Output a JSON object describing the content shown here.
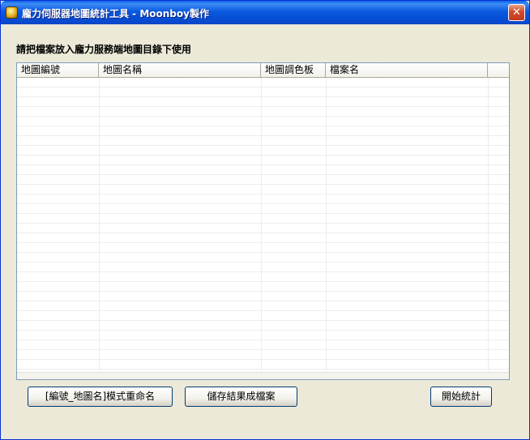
{
  "window": {
    "title": "龐力伺服器地圖統計工具 - Moonboy製作",
    "close_label": "✕"
  },
  "instruction": "請把檔案放入龐力服務端地圖目錄下使用",
  "list": {
    "columns": [
      "地圖編號",
      "地圖名稱",
      "地圖調色板",
      "檔案名"
    ],
    "rows": []
  },
  "buttons": {
    "rename": "[編號_地圖名]模式重命名",
    "save": "儲存結果成檔案",
    "start": "開始統計"
  }
}
